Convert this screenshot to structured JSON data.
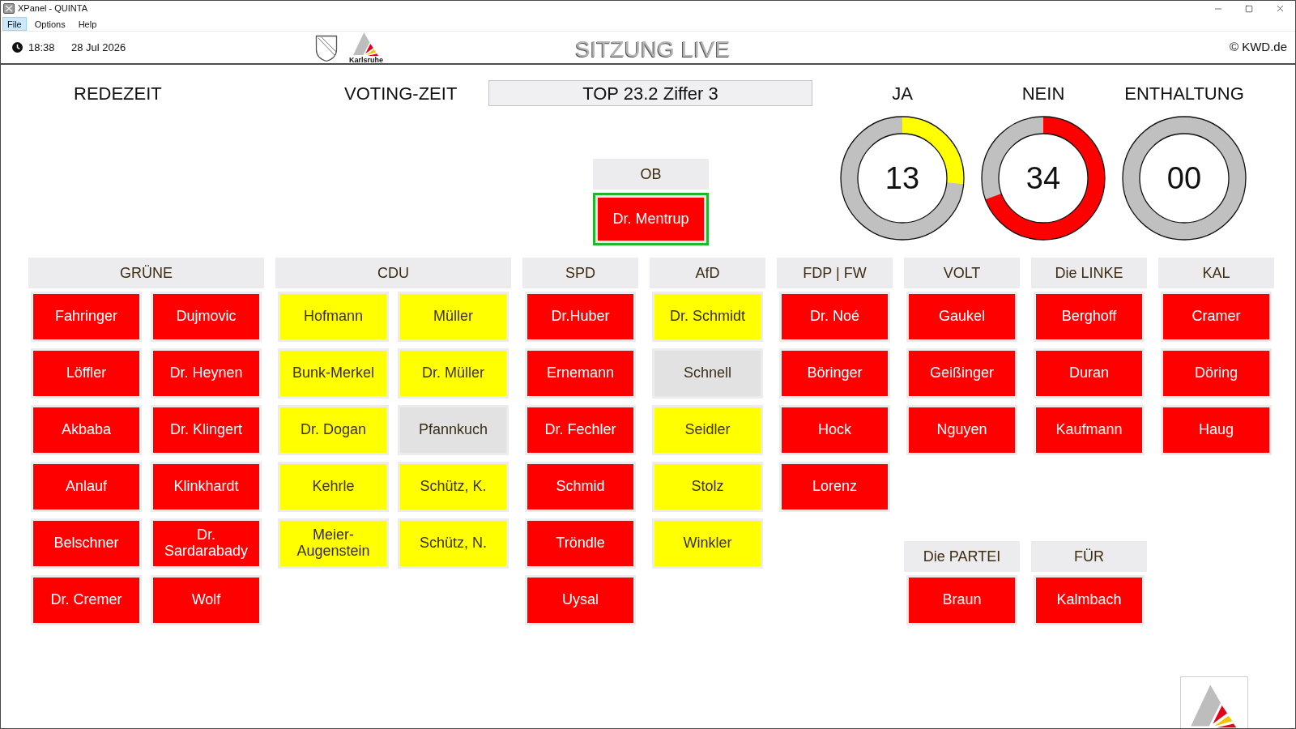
{
  "window": {
    "title": "XPanel - QUINTA"
  },
  "menu": [
    {
      "label": "File",
      "selected": true
    },
    {
      "label": "Options",
      "selected": false
    },
    {
      "label": "Help",
      "selected": false
    }
  ],
  "header": {
    "time": "18:38",
    "date": "28 Jul 2026",
    "logo_caption": "Karlsruhe",
    "title": "SITZUNG LIVE",
    "copyright": "© KWD.de"
  },
  "speaking_time_label": "REDEZEIT",
  "voting_time_label": "VOTING-ZEIT",
  "agenda_item": "TOP 23.2 Ziffer 3",
  "gauges": [
    {
      "label": "JA",
      "value": "13",
      "color": "#ffff00"
    },
    {
      "label": "NEIN",
      "value": "34",
      "color": "#ff0000"
    },
    {
      "label": "ENTHALTUNG",
      "value": "00"
    }
  ],
  "mayor": {
    "label": "OB",
    "name": "Dr. Mentrup",
    "color": "#ff0000",
    "highlighted": true
  },
  "party_columns": [
    {
      "parties": [
        {
          "name": "GRÜNE",
          "members": [
            {
              "name": "Fahringer",
              "color": "#ff0000"
            },
            {
              "name": "Dujmovic",
              "color": "#ff0000"
            },
            {
              "name": "Löffler",
              "color": "#ff0000"
            },
            {
              "name": "Dr. Heynen",
              "color": "#ff0000"
            },
            {
              "name": "Akbaba",
              "color": "#ff0000"
            },
            {
              "name": "Dr. Klingert",
              "color": "#ff0000"
            },
            {
              "name": "Anlauf",
              "color": "#ff0000"
            },
            {
              "name": "Klinkhardt",
              "color": "#ff0000"
            },
            {
              "name": "Belschner",
              "color": "#ff0000"
            },
            {
              "name": "Dr. Sardarabady",
              "color": "#ff0000"
            },
            {
              "name": "Dr. Cremer",
              "color": "#ff0000"
            },
            {
              "name": "Wolf",
              "color": "#ff0000"
            }
          ]
        }
      ]
    },
    {
      "parties": [
        {
          "name": "CDU",
          "members": [
            {
              "name": "Hofmann",
              "color": "#ffff00"
            },
            {
              "name": "Müller",
              "color": "#ffff00"
            },
            {
              "name": "Bunk-Merkel",
              "color": "#ffff00"
            },
            {
              "name": "Dr. Müller",
              "color": "#ffff00"
            },
            {
              "name": "Dr. Dogan",
              "color": "#ffff00"
            },
            {
              "name": "Pfannkuch",
              "color": "#e2e2e2"
            },
            {
              "name": "Kehrle",
              "color": "#ffff00"
            },
            {
              "name": "Schütz, K.",
              "color": "#ffff00"
            },
            {
              "name": "Meier-Augenstein",
              "color": "#ffff00"
            },
            {
              "name": "Schütz, N.",
              "color": "#ffff00"
            }
          ]
        }
      ]
    },
    {
      "parties": [
        {
          "name": "SPD",
          "members": [
            {
              "name": "Dr.Huber",
              "color": "#ff0000"
            },
            {
              "name": "Ernemann",
              "color": "#ff0000"
            },
            {
              "name": "Dr. Fechler",
              "color": "#ff0000"
            },
            {
              "name": "Schmid",
              "color": "#ff0000"
            },
            {
              "name": "Tröndle",
              "color": "#ff0000"
            },
            {
              "name": "Uysal",
              "color": "#ff0000"
            }
          ]
        }
      ]
    },
    {
      "parties": [
        {
          "name": "AfD",
          "members": [
            {
              "name": "Dr. Schmidt",
              "color": "#ffff00"
            },
            {
              "name": "Schnell",
              "color": "#e2e2e2"
            },
            {
              "name": "Seidler",
              "color": "#ffff00"
            },
            {
              "name": "Stolz",
              "color": "#ffff00"
            },
            {
              "name": "Winkler",
              "color": "#ffff00"
            }
          ]
        }
      ]
    },
    {
      "parties": [
        {
          "name": "FDP | FW",
          "members": [
            {
              "name": "Dr. Noé",
              "color": "#ff0000"
            },
            {
              "name": "Böringer",
              "color": "#ff0000"
            },
            {
              "name": "Hock",
              "color": "#ff0000"
            },
            {
              "name": "Lorenz",
              "color": "#ff0000"
            }
          ]
        }
      ]
    },
    {
      "parties": [
        {
          "name": "VOLT",
          "members": [
            {
              "name": "Gaukel",
              "color": "#ff0000"
            },
            {
              "name": "Geißinger",
              "color": "#ff0000"
            },
            {
              "name": "Nguyen",
              "color": "#ff0000"
            }
          ]
        },
        {
          "name": "Die PARTEI",
          "members": [
            {
              "name": "Braun",
              "color": "#ff0000"
            }
          ]
        }
      ]
    },
    {
      "parties": [
        {
          "name": "Die LINKE",
          "members": [
            {
              "name": "Berghoff",
              "color": "#ff0000"
            },
            {
              "name": "Duran",
              "color": "#ff0000"
            },
            {
              "name": "Kaufmann",
              "color": "#ff0000"
            }
          ]
        },
        {
          "name": "FÜR",
          "members": [
            {
              "name": "Kalmbach",
              "color": "#ff0000"
            }
          ]
        }
      ]
    },
    {
      "parties": [
        {
          "name": "KAL",
          "members": [
            {
              "name": "Cramer",
              "color": "#ff0000"
            },
            {
              "name": "Döring",
              "color": "#ff0000"
            },
            {
              "name": "Haug",
              "color": "#ff0000"
            }
          ]
        }
      ]
    }
  ]
}
